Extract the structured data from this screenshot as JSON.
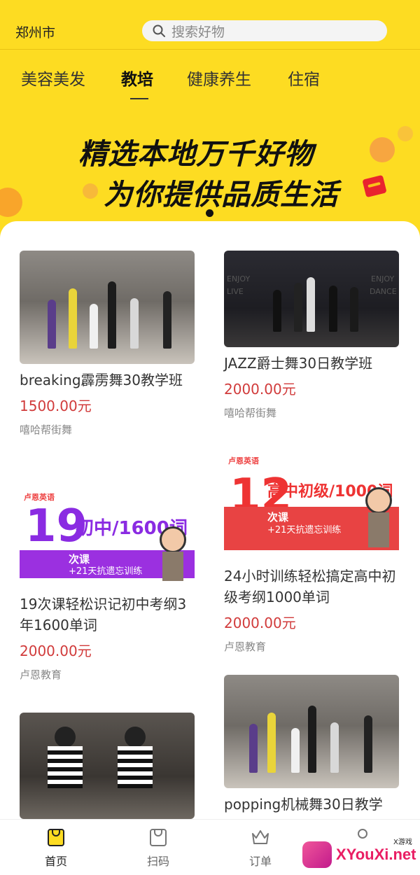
{
  "header": {
    "city": "郑州市",
    "search_placeholder": "搜索好物"
  },
  "tabs": [
    {
      "label": "美容美发"
    },
    {
      "label": "教培"
    },
    {
      "label": "健康养生"
    },
    {
      "label": "住宿"
    }
  ],
  "banner": {
    "line1": "精选本地万千好物",
    "line2": "为你提供品质生活"
  },
  "products": [
    {
      "title": "breaking霹雳舞30教学班",
      "price": "1500.00元",
      "shop": "嘻哈帮街舞"
    },
    {
      "title": "JAZZ爵士舞30日教学班",
      "price": "2000.00元",
      "shop": "嘻哈帮街舞",
      "image_text": [
        "ENJOY",
        "LIVE",
        "ENJOY",
        "DANCE"
      ]
    },
    {
      "title": "19次课轻松识记初中考纲3年1600单词",
      "price": "2000.00元",
      "shop": "卢恩教育",
      "image_text": {
        "brand": "卢恩英语",
        "num": "19",
        "headline": "初中/1600词",
        "sub": "次课",
        "tag": "+21天抗遗忘训练"
      }
    },
    {
      "title": "24小时训练轻松搞定高中初级考纲1000单词",
      "price": "2000.00元",
      "shop": "卢恩教育",
      "image_text": {
        "brand": "卢恩英语",
        "num": "12",
        "headline": "高中初级/1000词",
        "sub": "次课",
        "tag": "+21天抗遗忘训练"
      }
    },
    {
      "title": "",
      "price": "",
      "shop": ""
    },
    {
      "title": "popping机械舞30日教学",
      "price": "",
      "shop": ""
    }
  ],
  "bottom_nav": [
    {
      "label": "首页",
      "icon": "home-bag-icon",
      "active": true
    },
    {
      "label": "扫码",
      "icon": "scan-bag-icon",
      "active": false
    },
    {
      "label": "订单",
      "icon": "crown-icon",
      "active": false
    },
    {
      "label": "",
      "icon": "profile-icon",
      "active": false
    }
  ],
  "watermark": {
    "text": "XYouXi.net",
    "small": "X游戏"
  },
  "colors": {
    "header_bg": "#fddc22",
    "price": "#d13b3b",
    "active_nav": "#fddc22"
  }
}
